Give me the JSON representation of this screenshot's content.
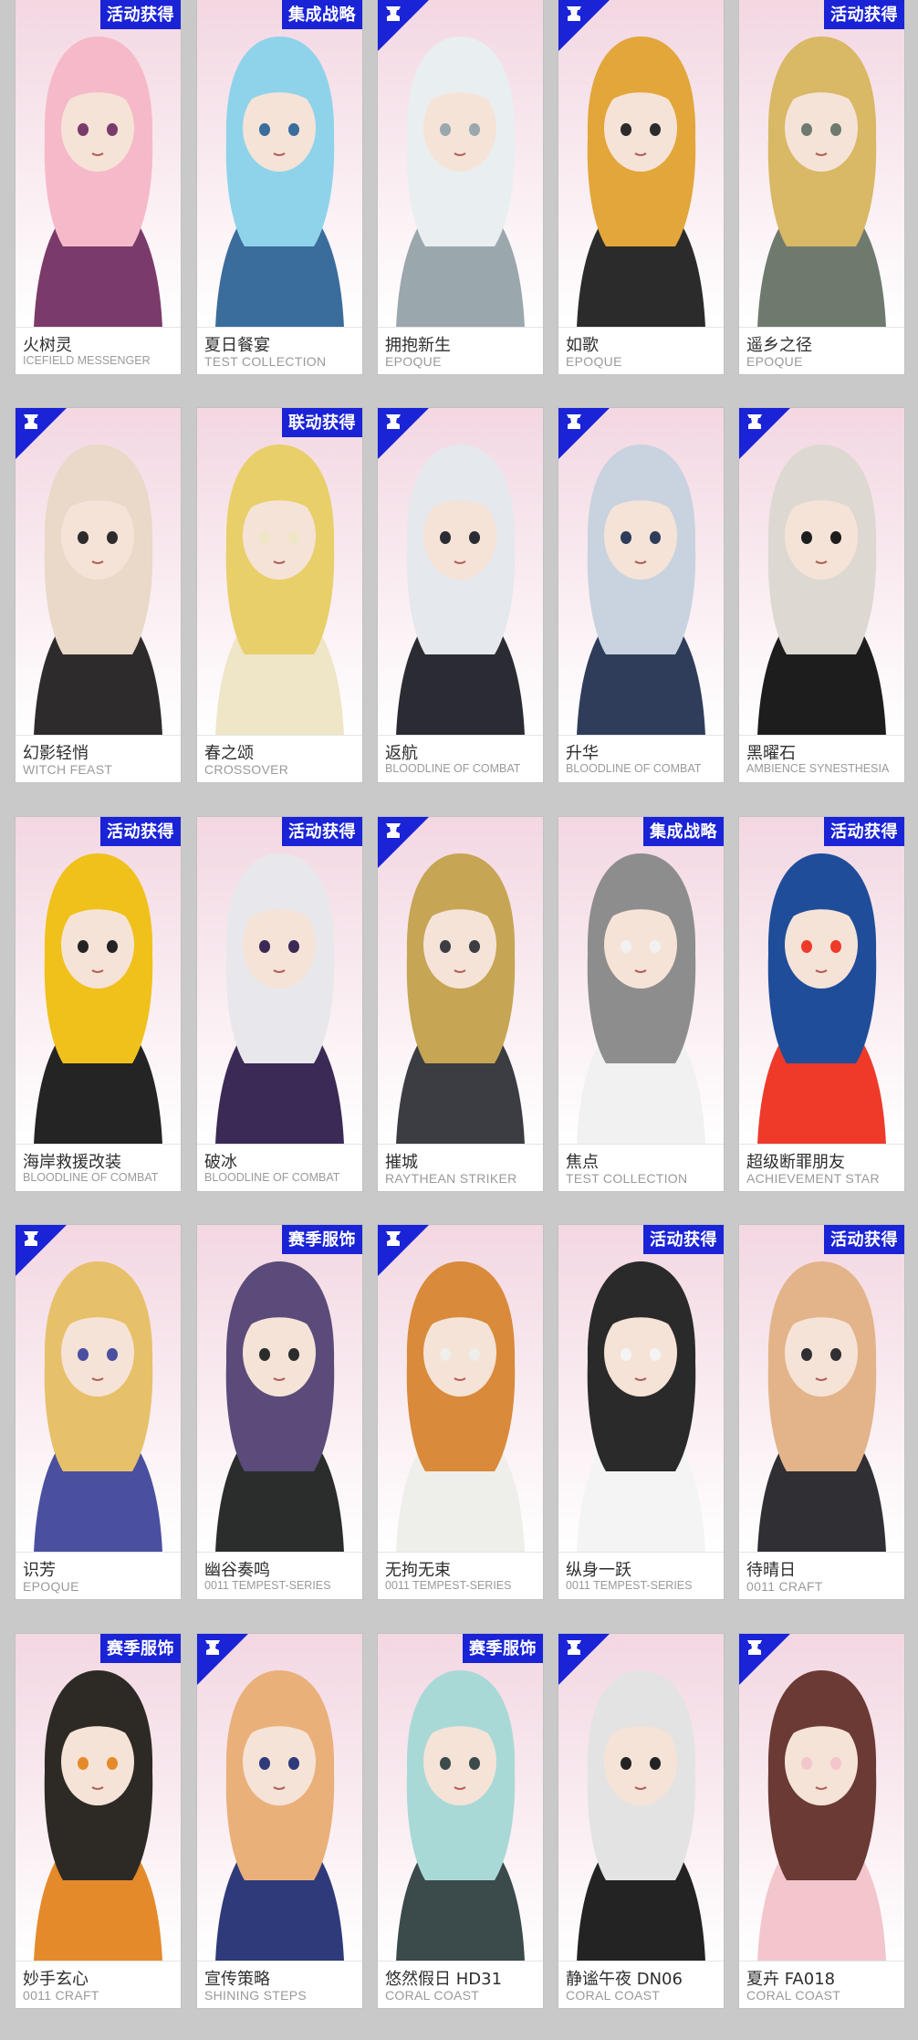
{
  "colors": {
    "accent": "#1a23d6",
    "background": "#c9c9c9"
  },
  "corner_icon": "chess-piece-icon",
  "rows": [
    {
      "cards": [
        {
          "name": "火树灵",
          "series": "ICEFIELD MESSENGER",
          "tag": "活动获得",
          "badge": false,
          "palette": [
            "#f6b9c9",
            "#7a3b6a",
            "#f3d7e2"
          ]
        },
        {
          "name": "夏日餐宴",
          "series": "TEST COLLECTION",
          "tag": "集成战略",
          "badge": false,
          "palette": [
            "#8fd3ea",
            "#3a6c9c",
            "#f4a64a"
          ]
        },
        {
          "name": "拥抱新生",
          "series": "EPOQUE",
          "tag": "",
          "badge": true,
          "palette": [
            "#e9eef0",
            "#9aa7ad",
            "#3a3a3a"
          ]
        },
        {
          "name": "如歌",
          "series": "EPOQUE",
          "tag": "",
          "badge": true,
          "palette": [
            "#e2a63a",
            "#2b2b2b",
            "#c98a2a"
          ]
        },
        {
          "name": "遥乡之径",
          "series": "EPOQUE",
          "tag": "活动获得",
          "badge": false,
          "palette": [
            "#d9b866",
            "#6f7a6f",
            "#f2eadb"
          ]
        }
      ]
    },
    {
      "cards": [
        {
          "name": "幻影轻悄",
          "series": "WITCH FEAST",
          "tag": "",
          "badge": true,
          "palette": [
            "#ead8c8",
            "#2d2b2b",
            "#caa89c"
          ]
        },
        {
          "name": "春之颂",
          "series": "CROSSOVER",
          "tag": "联动获得",
          "badge": false,
          "palette": [
            "#e8cf6a",
            "#efe6c8",
            "#8a6a3a"
          ]
        },
        {
          "name": "返航",
          "series": "BLOODLINE OF COMBAT",
          "tag": "",
          "badge": true,
          "palette": [
            "#e5e8ec",
            "#2b2b33",
            "#b23a3a"
          ]
        },
        {
          "name": "升华",
          "series": "BLOODLINE OF COMBAT",
          "tag": "",
          "badge": true,
          "palette": [
            "#c9d3df",
            "#2f3d5a",
            "#e6a93a"
          ]
        },
        {
          "name": "黑曜石",
          "series": "AMBIENCE SYNESTHESIA",
          "tag": "",
          "badge": true,
          "palette": [
            "#ded8d2",
            "#1d1d1d",
            "#7a6d66"
          ]
        }
      ]
    },
    {
      "cards": [
        {
          "name": "海岸救援改装",
          "series": "BLOODLINE OF COMBAT",
          "tag": "活动获得",
          "badge": false,
          "palette": [
            "#f0c11a",
            "#242424",
            "#f4f4f4"
          ]
        },
        {
          "name": "破冰",
          "series": "BLOODLINE OF COMBAT",
          "tag": "活动获得",
          "badge": false,
          "palette": [
            "#e8e8ec",
            "#3b2a55",
            "#8c67b9"
          ]
        },
        {
          "name": "摧城",
          "series": "RAYTHEAN STRIKER",
          "tag": "",
          "badge": true,
          "palette": [
            "#c6a554",
            "#3b3d42",
            "#8b8f96"
          ]
        },
        {
          "name": "焦点",
          "series": "TEST COLLECTION",
          "tag": "集成战略",
          "badge": false,
          "palette": [
            "#8d8d8d",
            "#f1f1f1",
            "#b32a2a"
          ]
        },
        {
          "name": "超级断罪朋友",
          "series": "ACHIEVEMENT STAR",
          "tag": "活动获得",
          "badge": false,
          "palette": [
            "#1f4d9a",
            "#ef3a2a",
            "#f3efe6"
          ]
        }
      ]
    },
    {
      "cards": [
        {
          "name": "识芳",
          "series": "EPOQUE",
          "tag": "",
          "badge": true,
          "palette": [
            "#e7c06a",
            "#4b4fa0",
            "#f2f2f6"
          ]
        },
        {
          "name": "幽谷奏鸣",
          "series": "0011 TEMPEST-SERIES",
          "tag": "赛季服饰",
          "badge": false,
          "palette": [
            "#5a4b7a",
            "#2a2d2b",
            "#7fc8a0"
          ]
        },
        {
          "name": "无拘无束",
          "series": "0011 TEMPEST-SERIES",
          "tag": "",
          "badge": true,
          "palette": [
            "#d98a3a",
            "#eeeeea",
            "#4e3a2a"
          ]
        },
        {
          "name": "纵身一跃",
          "series": "0011 TEMPEST-SERIES",
          "tag": "活动获得",
          "badge": false,
          "palette": [
            "#2a2a2a",
            "#f4f4f4",
            "#6b6f4e"
          ]
        },
        {
          "name": "待晴日",
          "series": "0011 CRAFT",
          "tag": "活动获得",
          "badge": false,
          "palette": [
            "#e3b48a",
            "#2f2f34",
            "#c6a08a"
          ]
        }
      ]
    },
    {
      "cards": [
        {
          "name": "妙手玄心",
          "series": "0011 CRAFT",
          "tag": "赛季服饰",
          "badge": false,
          "palette": [
            "#2d2a25",
            "#e58a2a",
            "#b92a2a"
          ]
        },
        {
          "name": "宣传策略",
          "series": "SHINING STEPS",
          "tag": "",
          "badge": true,
          "palette": [
            "#eab07a",
            "#2e3a7a",
            "#f1e6dc"
          ]
        },
        {
          "name": "悠然假日 HD31",
          "series": "CORAL COAST",
          "tag": "赛季服饰",
          "badge": false,
          "palette": [
            "#a9d9d6",
            "#3b4a4a",
            "#ececec"
          ]
        },
        {
          "name": "静谧午夜 DN06",
          "series": "CORAL COAST",
          "tag": "",
          "badge": true,
          "palette": [
            "#e3e3e3",
            "#232323",
            "#c9b27a"
          ]
        },
        {
          "name": "夏卉 FA018",
          "series": "CORAL COAST",
          "tag": "",
          "badge": true,
          "palette": [
            "#6b3a35",
            "#f2c6cc",
            "#e7e7ef"
          ]
        }
      ]
    }
  ]
}
